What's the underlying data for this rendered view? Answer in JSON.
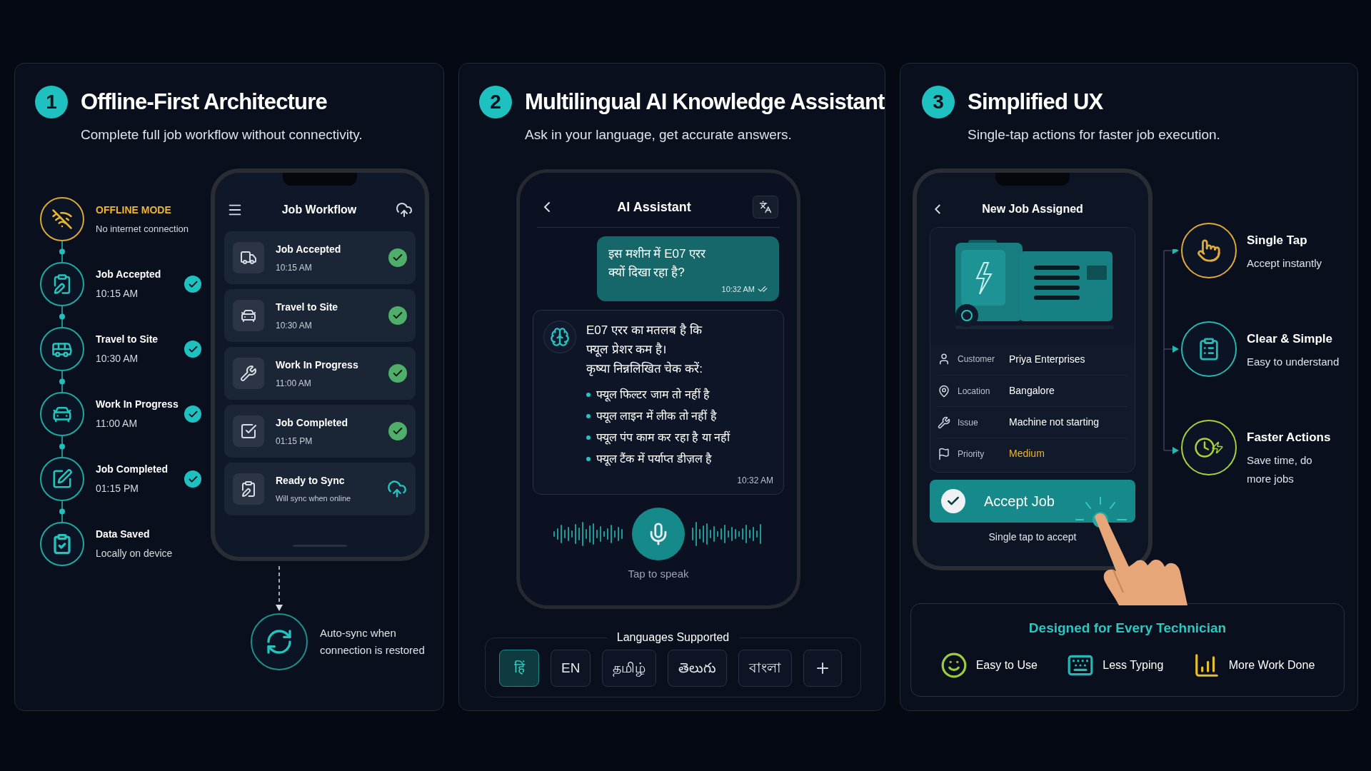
{
  "offline": {
    "number": "1",
    "title": "Offline-First Architecture",
    "subtitle": "Complete full job workflow without connectivity.",
    "timeline": [
      {
        "kind": "status",
        "title": "OFFLINE MODE",
        "detail": "No internet connection",
        "done": false
      },
      {
        "kind": "step",
        "title": "Job Accepted",
        "detail": "10:15 AM",
        "done": true
      },
      {
        "kind": "step",
        "title": "Travel to Site",
        "detail": "10:30 AM",
        "done": true
      },
      {
        "kind": "step",
        "title": "Work In Progress",
        "detail": "11:00 AM",
        "done": true
      },
      {
        "kind": "step",
        "title": "Job Completed",
        "detail": "01:15 PM",
        "done": true
      },
      {
        "kind": "saved",
        "title": "Data Saved",
        "detail": "Locally on device",
        "done": false
      }
    ],
    "phone": {
      "title": "Job Workflow",
      "items": [
        {
          "kind": "done",
          "title": "Job Accepted",
          "detail": "10:15 AM"
        },
        {
          "kind": "done",
          "title": "Travel to Site",
          "detail": "10:30 AM"
        },
        {
          "kind": "done",
          "title": "Work In Progress",
          "detail": "11:00 AM"
        },
        {
          "kind": "done",
          "title": "Job Completed",
          "detail": "01:15 PM"
        },
        {
          "kind": "sync",
          "title": "Ready to Sync",
          "detail": "Will sync when online"
        }
      ]
    },
    "auto_sync": "Auto-sync when\nconnection is restored"
  },
  "assistant": {
    "number": "2",
    "title": "Multilingual AI Knowledge Assistant",
    "subtitle": "Ask in your language, get accurate answers.",
    "phone": {
      "title": "AI Assistant",
      "question": "इस मशीन में E07 एरर\nक्यों दिखा रहा है?",
      "question_time": "10:32 AM",
      "answer": "E07 एरर का मतलब है कि\nफ्यूल प्रेशर कम है।\nकृष्या निन्नलिखित चेक करें:",
      "bullets": [
        "फ्यूल फिल्टर जाम तो नहीं है",
        "फ्यूल लाइन में लीक तो नहीं है",
        "फ्यूल पंप काम कर रहा है या नहीं",
        "फ्यूल टैंक में पर्याप्त डीज़ल है"
      ],
      "answer_time": "10:32 AM",
      "mic_label": "Tap to speak"
    },
    "languages": {
      "title": "Languages Supported",
      "options": [
        {
          "label": "हिं",
          "selected": true
        },
        {
          "label": "EN",
          "selected": false
        },
        {
          "label": "தமிழ்",
          "selected": false
        },
        {
          "label": "తెలుగు",
          "selected": false
        },
        {
          "label": "বাংলা",
          "selected": false
        }
      ]
    }
  },
  "ux": {
    "number": "3",
    "title": "Simplified UX",
    "subtitle": "Single-tap actions for faster job execution.",
    "phone": {
      "title": "New Job Assigned",
      "details": [
        {
          "kind": "text",
          "label": "Customer",
          "value": "Priya Enterprises"
        },
        {
          "kind": "text",
          "label": "Location",
          "value": "Bangalore"
        },
        {
          "kind": "text",
          "label": "Issue",
          "value": "Machine not starting"
        },
        {
          "kind": "priority",
          "label": "Priority",
          "value": "Medium"
        }
      ],
      "button": "Accept Job",
      "hint": "Single tap to accept"
    },
    "features": [
      {
        "title": "Single Tap",
        "detail": "Accept instantly",
        "color": "#e0a93a"
      },
      {
        "title": "Clear & Simple",
        "detail": "Easy to understand",
        "color": "#25b8b4"
      },
      {
        "title": "Faster Actions",
        "detail": "Save time, do\nmore jobs",
        "color": "#a8d13a"
      }
    ],
    "designed": {
      "title": "Designed for Every Technician",
      "items": [
        "Easy to Use",
        "Less Typing",
        "More Work Done"
      ]
    }
  }
}
